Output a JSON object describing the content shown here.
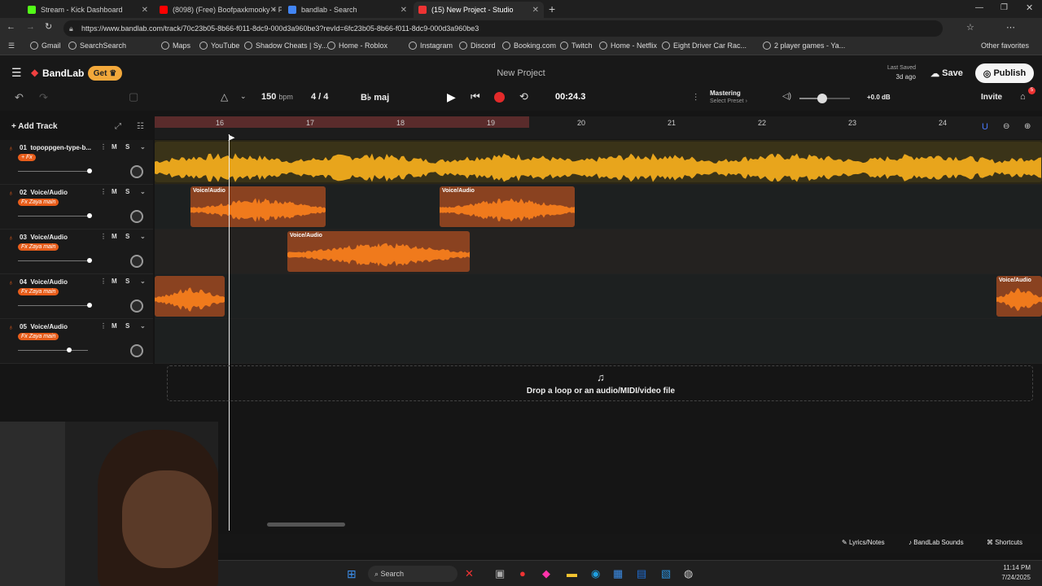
{
  "browser": {
    "tabs": [
      {
        "title": "Stream - Kick Dashboard",
        "color": "#53fc18"
      },
      {
        "title": "(8098) (Free) Boofpaxkmooky + P",
        "color": "#ff0000"
      },
      {
        "title": "bandlab - Search",
        "color": "#4285f4"
      },
      {
        "title": "(15) New Project - Studio",
        "color": "#e33"
      }
    ],
    "url": "https://www.bandlab.com/track/70c23b05-8b66-f011-8dc9-000d3a960be3?revId=6fc23b05-8b66-f011-8dc9-000d3a960be3",
    "bookmarks": [
      "Gmail",
      "SearchSearch",
      "Maps",
      "YouTube",
      "Shadow Cheats | Sy...",
      "Home - Roblox",
      "Instagram",
      "Discord",
      "Booking.com",
      "Twitch",
      "Home - Netflix",
      "Eight Driver Car Rac...",
      "2 player games - Ya..."
    ],
    "other_favorites": "Other favorites"
  },
  "app": {
    "logo": "BandLab",
    "get_label": "Get",
    "project_title": "New Project",
    "last_saved_label": "Last Saved",
    "last_saved_value": "3d ago",
    "save_label": "Save",
    "publish_label": "Publish",
    "invite_label": "Invite",
    "notification_count": "5"
  },
  "toolbar": {
    "tempo": "150",
    "tempo_unit": "bpm",
    "time_sig": "4 / 4",
    "key": "B♭ maj",
    "time": "00:24.3",
    "mastering_label": "Mastering",
    "mastering_preset": "Select Preset",
    "volume_db": "+0.0 dB",
    "volume_level": 0.45,
    "add_track_label": "Add Track"
  },
  "ruler": {
    "ticks": [
      "16",
      "17",
      "18",
      "19",
      "20",
      "21",
      "22",
      "23",
      "24"
    ]
  },
  "tracks": [
    {
      "num": "01",
      "name": "topoppgen-type-b...",
      "fx": "+ Fx",
      "volume": 0.85
    },
    {
      "num": "02",
      "name": "Voice/Audio",
      "fx": "Fx Zaya main",
      "volume": 0.85
    },
    {
      "num": "03",
      "name": "Voice/Audio",
      "fx": "Fx Zaya main",
      "volume": 0.85
    },
    {
      "num": "04",
      "name": "Voice/Audio",
      "fx": "Fx Zaya main",
      "volume": 0.85
    },
    {
      "num": "05",
      "name": "Voice/Audio",
      "fx": "Fx Zaya main",
      "volume": 0.6
    }
  ],
  "clip_label": "Voice/Audio",
  "mute_label": "M",
  "solo_label": "S",
  "drop_text": "Drop a loop or an audio/MIDI/video file",
  "bottom": {
    "lyrics": "Lyrics/Notes",
    "sounds": "BandLab Sounds",
    "shortcuts": "Shortcuts"
  },
  "taskbar": {
    "search": "Search",
    "time": "11:14 PM",
    "date": "7/24/2025"
  }
}
